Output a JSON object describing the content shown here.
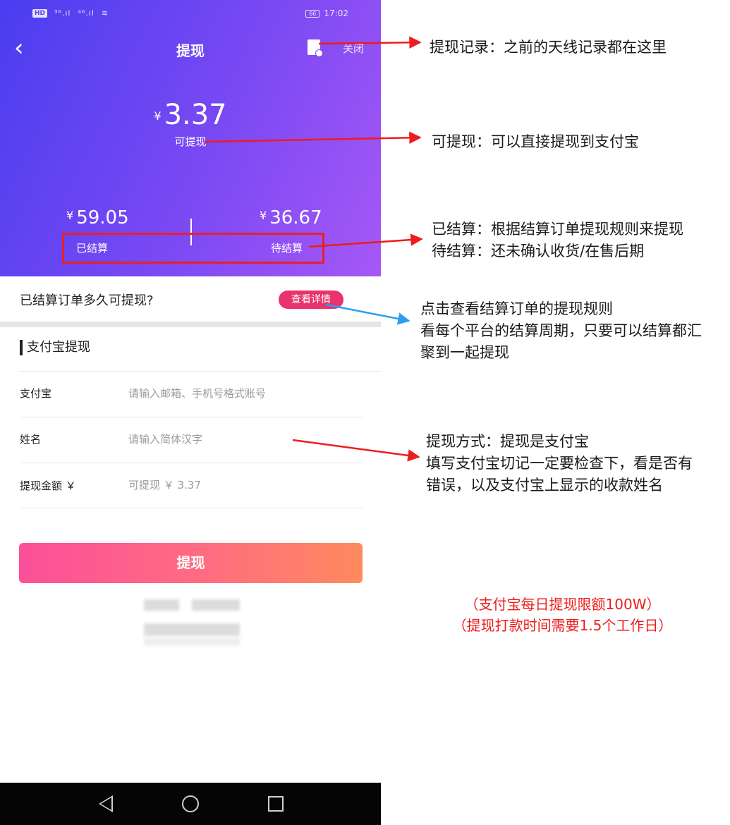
{
  "status_bar": {
    "hd": "HD",
    "sig1": "³⁶.ıl",
    "sig2": "⁴⁶.ıl",
    "battery": "66",
    "time": "17:02"
  },
  "nav": {
    "title": "提现",
    "close": "关闭"
  },
  "balance": {
    "currency": "¥",
    "available_value": "3.37",
    "available_label": "可提现",
    "settled_value": "59.05",
    "settled_label": "已结算",
    "pending_value": "36.67",
    "pending_label": "待结算"
  },
  "question": {
    "text": "已结算订单多久可提现?",
    "detail_btn": "查看详情"
  },
  "alipay_section": {
    "title": "支付宝提现",
    "account_label": "支付宝",
    "account_placeholder": "请输入邮箱、手机号格式账号",
    "name_label": "姓名",
    "name_placeholder": "请输入简体汉字",
    "amount_label": "提现金额 ￥",
    "amount_placeholder": "可提现 ￥ 3.37",
    "submit": "提现"
  },
  "annotations": {
    "record": "提现记录：之前的天线记录都在这里",
    "available": "可提现：可以直接提现到支付宝",
    "settled_1": "已结算：根据结算订单提现规则来提现",
    "settled_2": "待结算：还未确认收货/在售后期",
    "rules_1": "点击查看结算订单的提现规则",
    "rules_2": "看每个平台的结算周期，只要可以结算都汇",
    "rules_3": "聚到一起提现",
    "method_1": "提现方式：提现是支付宝",
    "method_2": "填写支付宝切记一定要检查下，看是否有",
    "method_3": "错误，以及支付宝上显示的收款姓名",
    "limit_1": "（支付宝每日提现限额100W）",
    "limit_2": "（提现打款时间需要1.5个工作日）"
  },
  "colors": {
    "hero_start": "#4a3ef0",
    "hero_end": "#a658f6",
    "button_start": "#fc4f9a",
    "button_end": "#ff8a5d",
    "annotation_red": "#ee1c1c",
    "annotation_blue": "#2a9df4"
  }
}
